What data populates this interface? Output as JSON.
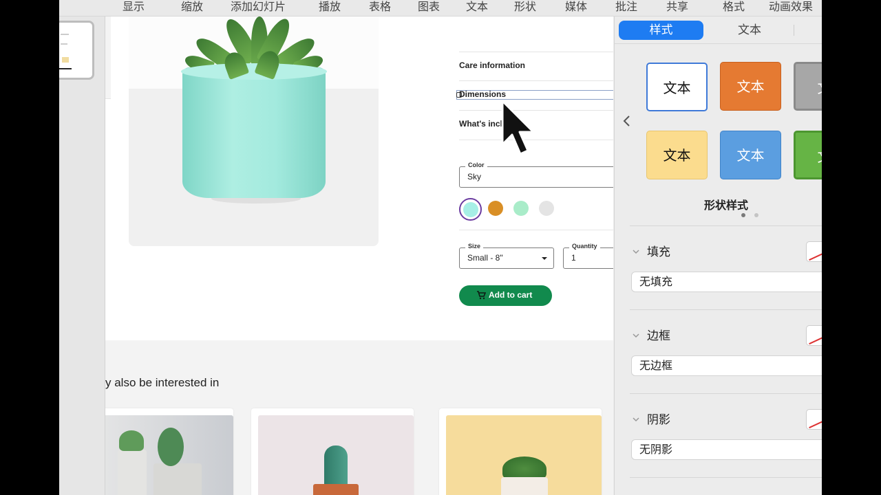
{
  "toolbar": {
    "items": [
      "显示",
      "缩放",
      "添加幻灯片",
      "播放",
      "表格",
      "图表",
      "文本",
      "形状",
      "媒体",
      "批注",
      "共享",
      "格式",
      "动画效果"
    ]
  },
  "product": {
    "accordion": [
      "Care information",
      "Dimensions",
      "What's included"
    ],
    "color": {
      "label": "Color",
      "value": "Sky"
    },
    "swatch_colors": [
      "#a6efe6",
      "#d98f26",
      "#a9ecc9",
      "#e4e4e4"
    ],
    "size": {
      "label": "Size",
      "value": "Small - 8\""
    },
    "quantity": {
      "label": "Quantity",
      "value": "1"
    },
    "add_to_cart": "Add to cart",
    "button_color": "#118a4d"
  },
  "recommend": {
    "title": "y also be interested in"
  },
  "inspector": {
    "tabs": [
      "样式",
      "文本"
    ],
    "style_tile_text": "文本",
    "style_tiles_row1": [
      "文本",
      "文本",
      "文"
    ],
    "style_tiles_row2": [
      "文本",
      "文本",
      "文"
    ],
    "shape_styles_label": "形状样式",
    "fill": {
      "title": "填充",
      "value": "无填充"
    },
    "border": {
      "title": "边框",
      "value": "无边框"
    },
    "shadow": {
      "title": "阴影",
      "value": "无阴影"
    },
    "accent": "#1e7cf2"
  }
}
